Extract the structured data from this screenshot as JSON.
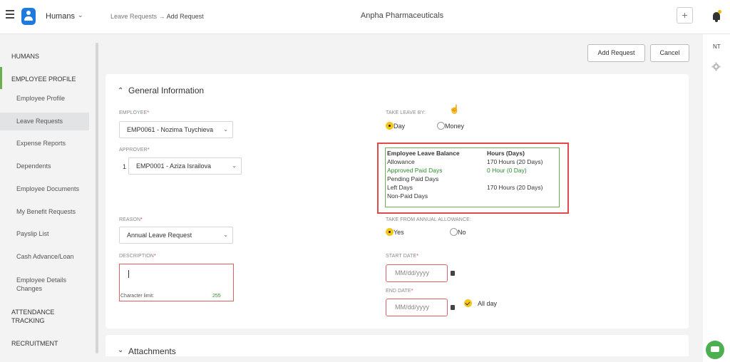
{
  "topbar": {
    "app_name": "Humans",
    "breadcrumb_parent": "Leave Requests",
    "breadcrumb_sep": " → ",
    "breadcrumb_current": "Add Request",
    "company": "Anpha Pharmaceuticals",
    "plus_label": "+"
  },
  "sidebar": {
    "section_humans": "HUMANS",
    "section_profile": "EMPLOYEE PROFILE",
    "items": [
      {
        "label": "Employee Profile"
      },
      {
        "label": "Leave Requests"
      },
      {
        "label": "Expense Reports"
      },
      {
        "label": "Dependents"
      },
      {
        "label": "Employee Documents"
      },
      {
        "label": "My Benefit Requests"
      },
      {
        "label": "Payslip List"
      },
      {
        "label": "Cash Advance/Loan"
      },
      {
        "label": "Employee Details Changes"
      }
    ],
    "section_attendance": "ATTENDANCE TRACKING",
    "section_recruitment": "RECRUITMENT"
  },
  "right_rail": {
    "initials": "NT"
  },
  "actions": {
    "add_request": "Add Request",
    "cancel": "Cancel"
  },
  "general": {
    "title": "General Information",
    "employee_label": "EMPLOYEE",
    "employee_value": "EMP0061 - Nozima Tuychieva",
    "approver_label": "APPROVER",
    "approver_index": "1",
    "approver_value": "EMP0001 - Aziza Israilova",
    "reason_label": "REASON",
    "reason_value": "Annual Leave Request",
    "description_label": "DESCRIPTION",
    "char_limit_label": "Character limit:",
    "char_limit_value": "255",
    "take_leave_label": "TAKE LEAVE BY:",
    "take_leave_options": [
      "Day",
      "Money"
    ],
    "balance": {
      "header_left": "Employee Leave Balance",
      "header_right": "Hours (Days)",
      "rows": [
        {
          "label": "Allowance",
          "value": "170 Hours (20 Days)"
        },
        {
          "label": "Approved Paid Days",
          "value": "0 Hour (0 Day)"
        },
        {
          "label": "Pending Paid Days",
          "value": ""
        },
        {
          "label": "Left Days",
          "value": "170 Hours (20 Days)"
        },
        {
          "label": "Non-Paid Days",
          "value": ""
        }
      ]
    },
    "annual_label": "TAKE FROM ANNUAL ALLOWANCE:",
    "annual_options": [
      "Yes",
      "No"
    ],
    "start_label": "START DATE",
    "start_placeholder": "MM/dd/yyyy",
    "end_label": "END DATE",
    "end_placeholder": "MM/dd/yyyy",
    "all_day_label": "All day"
  },
  "attachments": {
    "title": "Attachments"
  },
  "colors": {
    "accent": "#6ab04c",
    "highlight": "#e0494a",
    "selected_radio": "#f5c518"
  }
}
